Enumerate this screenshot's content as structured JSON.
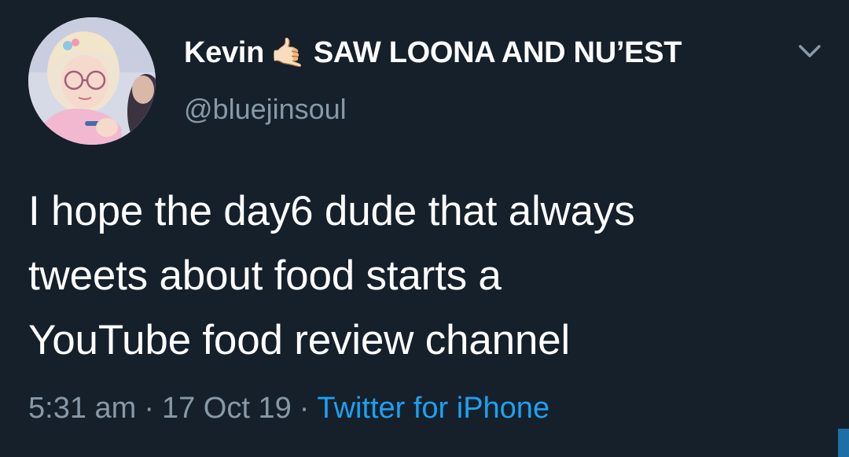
{
  "tweet": {
    "author": {
      "display_name": "Kevin",
      "name_emoji": "🤙🏻",
      "name_suffix": "SAW LOONA AND NU’EST",
      "handle": "@bluejinsoul",
      "avatar_icon": "profile-photo"
    },
    "text_lines": [
      "I hope the day6 dude that always",
      "tweets about food starts a",
      "YouTube food review channel"
    ],
    "time": "5:31 am",
    "date": "17 Oct 19",
    "separator": "·",
    "source": "Twitter for iPhone",
    "menu_icon": "chevron-down-icon"
  },
  "colors": {
    "background": "#15202b",
    "text": "#ffffff",
    "muted": "#8899a6",
    "link": "#1da1f2"
  }
}
